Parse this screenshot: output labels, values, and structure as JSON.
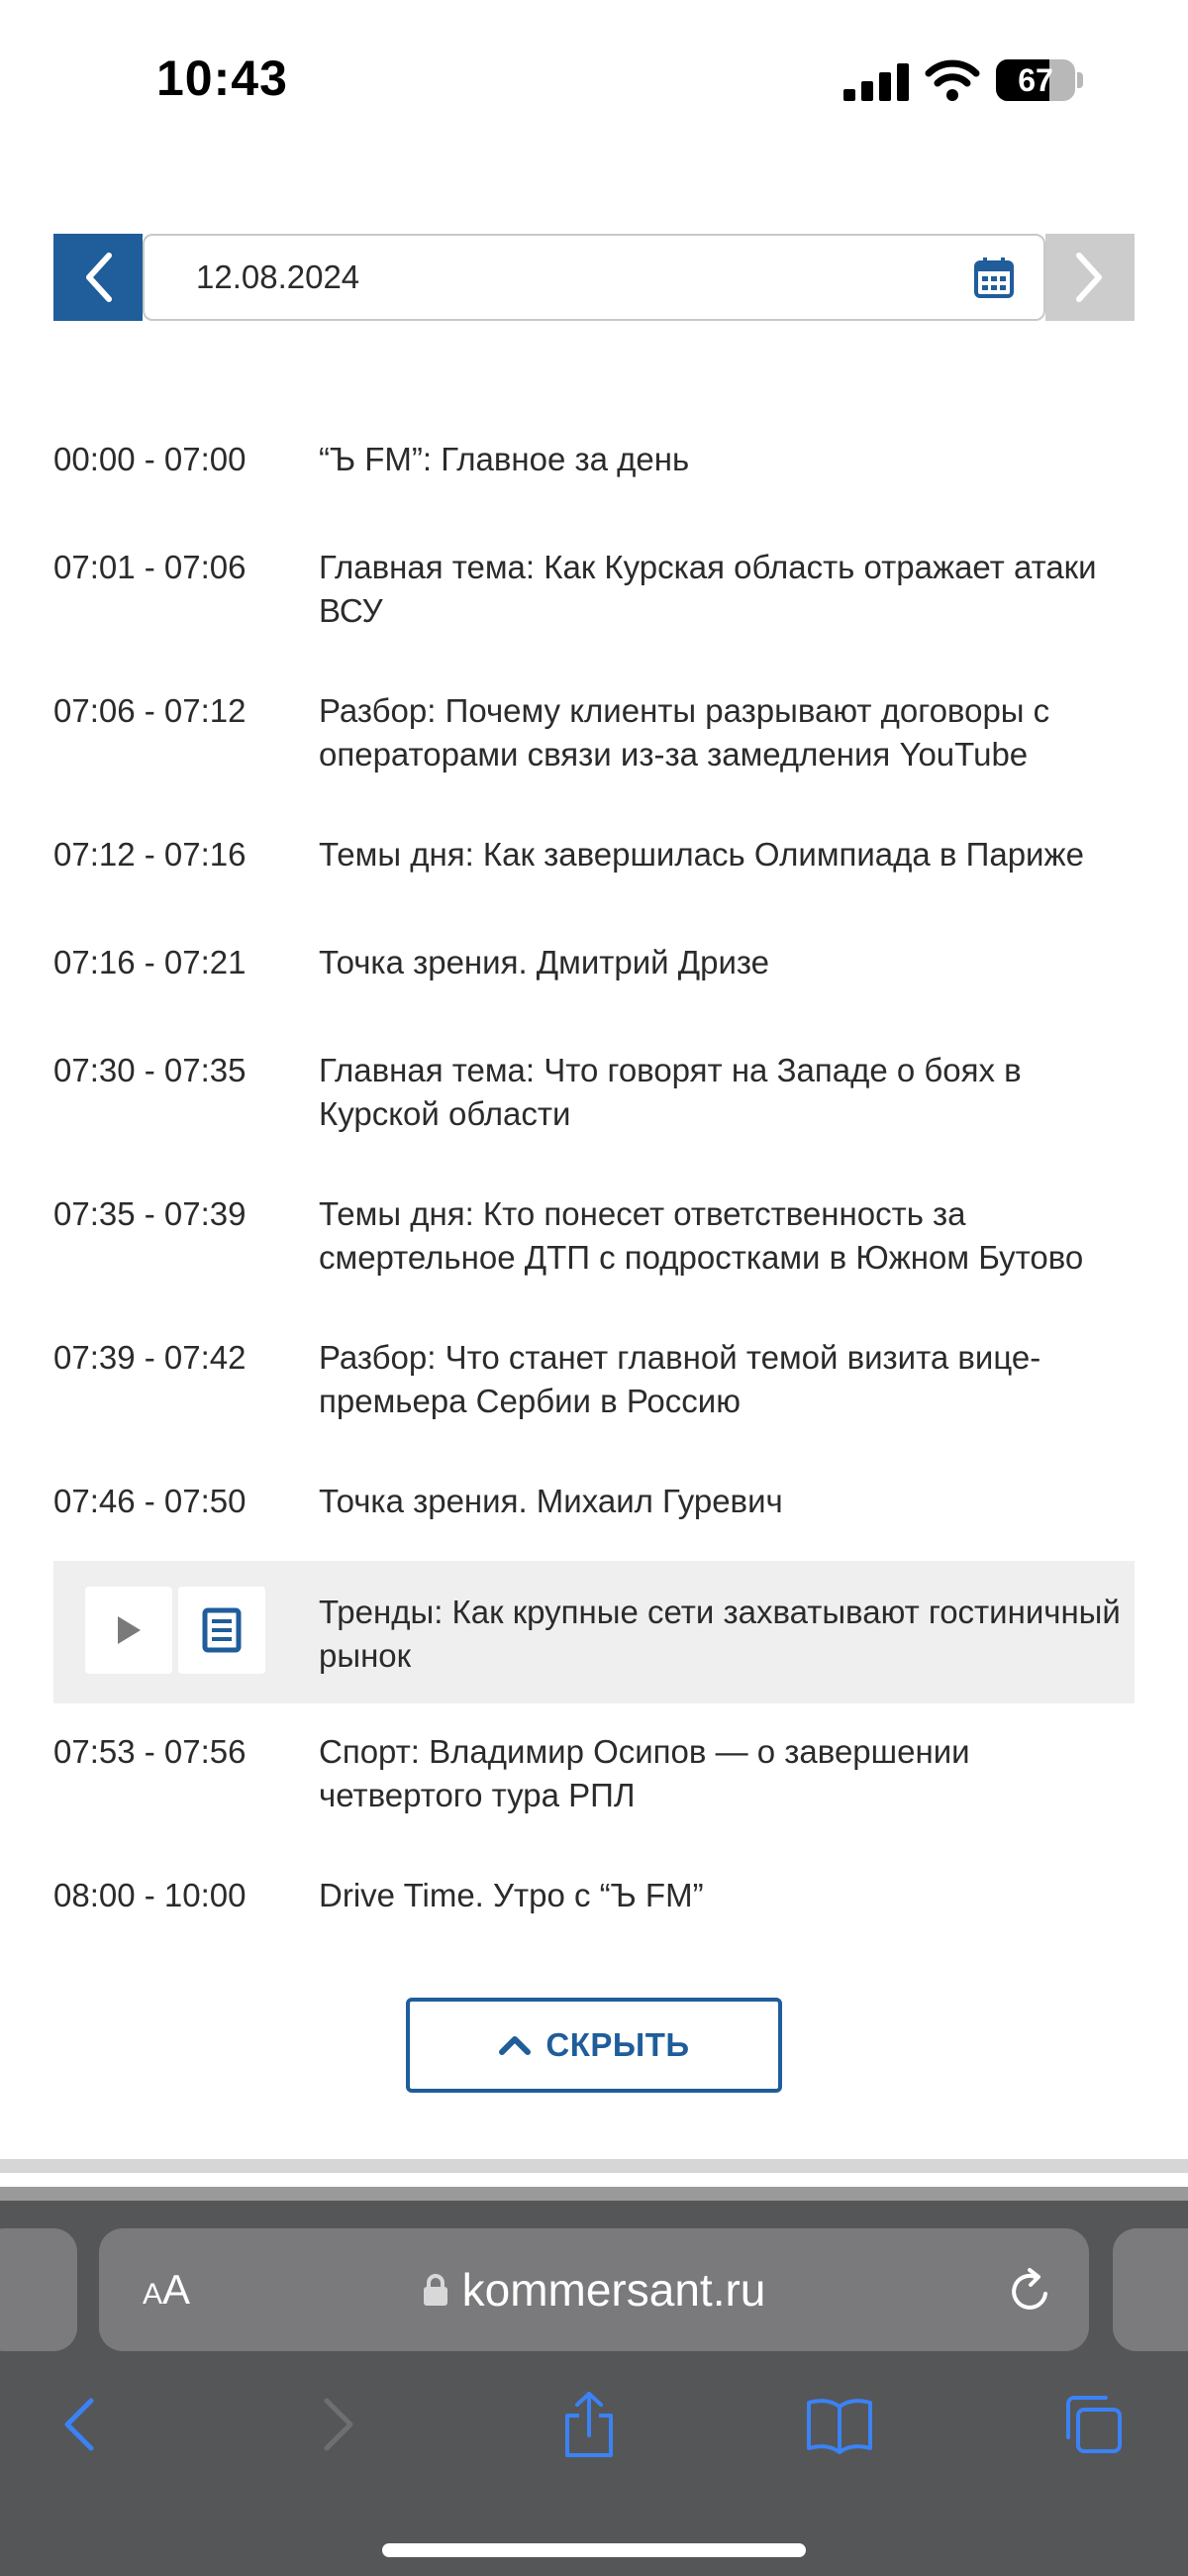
{
  "status_bar": {
    "time": "10:43",
    "battery_percent": 67,
    "battery_label": "67"
  },
  "date_picker": {
    "value": "12.08.2024"
  },
  "schedule": [
    {
      "time": "00:00 - 07:00",
      "title": "“Ъ FM”: Главное за день"
    },
    {
      "time": "07:01 - 07:06",
      "title": "Главная тема: Как Курская область отражает атаки ВСУ"
    },
    {
      "time": "07:06 - 07:12",
      "title": "Разбор: Почему клиенты разрывают договоры с операторами связи из-за замедления YouTube"
    },
    {
      "time": "07:12 - 07:16",
      "title": "Темы дня: Как завершилась Олимпиада в Париже"
    },
    {
      "time": "07:16 - 07:21",
      "title": "Точка зрения. Дмитрий Дризе"
    },
    {
      "time": "07:30 - 07:35",
      "title": "Главная тема: Что говорят на Западе о боях в Курской области"
    },
    {
      "time": "07:35 - 07:39",
      "title": "Темы дня: Кто понесет ответственность за смертельное ДТП с подростками в Южном Бутово"
    },
    {
      "time": "07:39 - 07:42",
      "title": "Разбор: Что станет главной темой визита вице-премьера Сербии в Россию"
    },
    {
      "time": "07:46 - 07:50",
      "title": "Точка зрения. Михаил Гуревич"
    },
    {
      "time": "",
      "title": "Тренды: Как крупные сети захватывают гостиничный рынок",
      "active": true
    },
    {
      "time": "07:53 - 07:56",
      "title": "Спорт: Владимир Осипов — о завершении четвертого тура РПЛ"
    },
    {
      "time": "08:00 - 10:00",
      "title": "Drive Time. Утро с “Ъ FM”"
    }
  ],
  "hide_button": {
    "label": "СКРЫТЬ"
  },
  "browser": {
    "aa_small": "A",
    "aa_big": "A",
    "url": "kommersant.ru"
  },
  "colors": {
    "accent": "#1f5d9b",
    "active_row": "#efefef",
    "chrome": "#555658"
  },
  "icons": {
    "prev": "chevron-left-icon",
    "next": "chevron-right-icon",
    "calendar": "calendar-icon",
    "play": "play-icon",
    "document": "document-icon",
    "hide": "chevron-up-icon",
    "lock": "lock-icon",
    "reload": "reload-icon",
    "back": "back-icon",
    "forward": "forward-icon",
    "share": "share-icon",
    "bookmarks": "bookmarks-icon",
    "tabs": "tabs-icon"
  }
}
